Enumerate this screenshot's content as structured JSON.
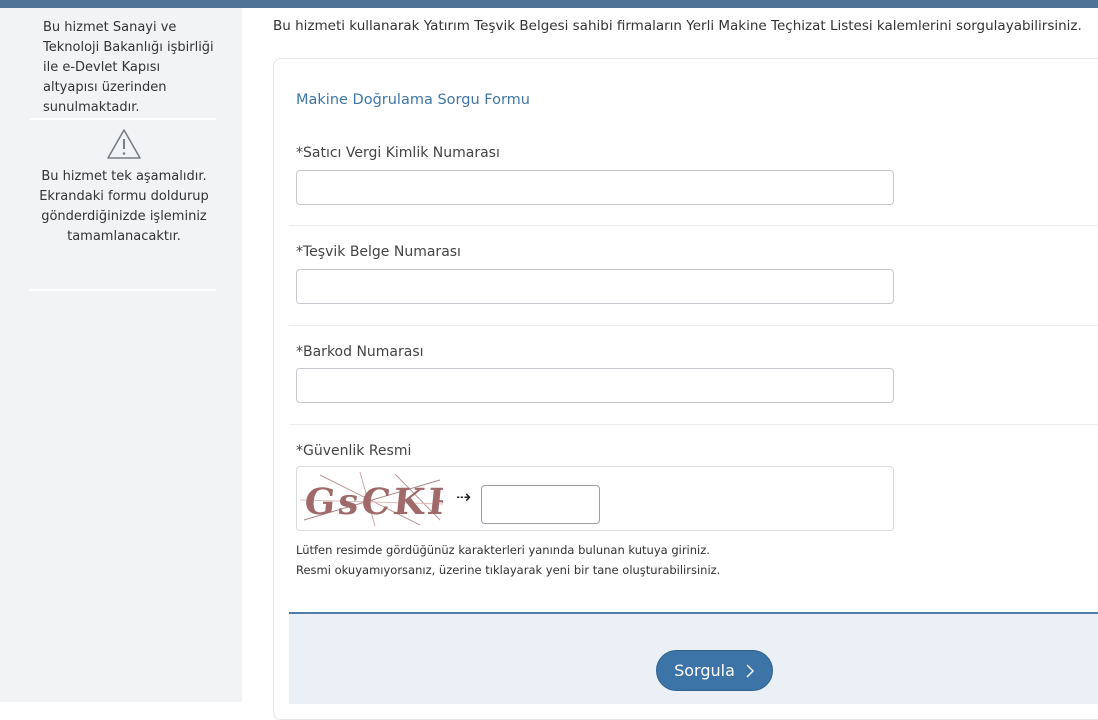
{
  "sidebar": {
    "info_text": "Bu hizmet Sanayi ve Teknoloji Bakanlığı işbirliği ile e-Devlet Kapısı altyapısı üzerinden sunulmaktadır.",
    "warning_icon": "warning-triangle-icon",
    "step_text": "Bu hizmet tek aşamalıdır. Ekrandaki formu doldurup gönderdiğinizde işleminiz tamamlanacaktır."
  },
  "intro_text": "Bu hizmeti kullanarak Yatırım Teşvik Belgesi sahibi firmaların Yerli Makine Teçhizat Listesi kalemlerini sorgulayabilirsiniz.",
  "form": {
    "title": "Makine Doğrulama Sorgu Formu",
    "required_mark": "*",
    "fields": [
      {
        "label": "Satıcı Vergi Kimlik Numarası",
        "value": "",
        "placeholder": ""
      },
      {
        "label": "Teşvik Belge Numarası",
        "value": "",
        "placeholder": ""
      },
      {
        "label": "Barkod Numarası",
        "value": "",
        "placeholder": ""
      }
    ],
    "captcha": {
      "label": "Güvenlik Resmi",
      "image_text": "GsCKR",
      "arrow": "⇢",
      "value": "",
      "hint_line1": "Lütfen resimde gördüğünüz karakterleri yanında bulunan kutuya giriniz.",
      "hint_line2": "Resmi okuyamıyorsanız, üzerine tıklayarak yeni bir tane oluşturabilirsiniz."
    },
    "submit_label": "Sorgula",
    "submit_icon": "chevron-right-icon"
  },
  "colors": {
    "accent": "#3d74a8",
    "title": "#3f76a6",
    "topbar": "#4e7396",
    "sidebar_bg": "#f2f3f5",
    "footer_bg": "#eaf0f6"
  }
}
